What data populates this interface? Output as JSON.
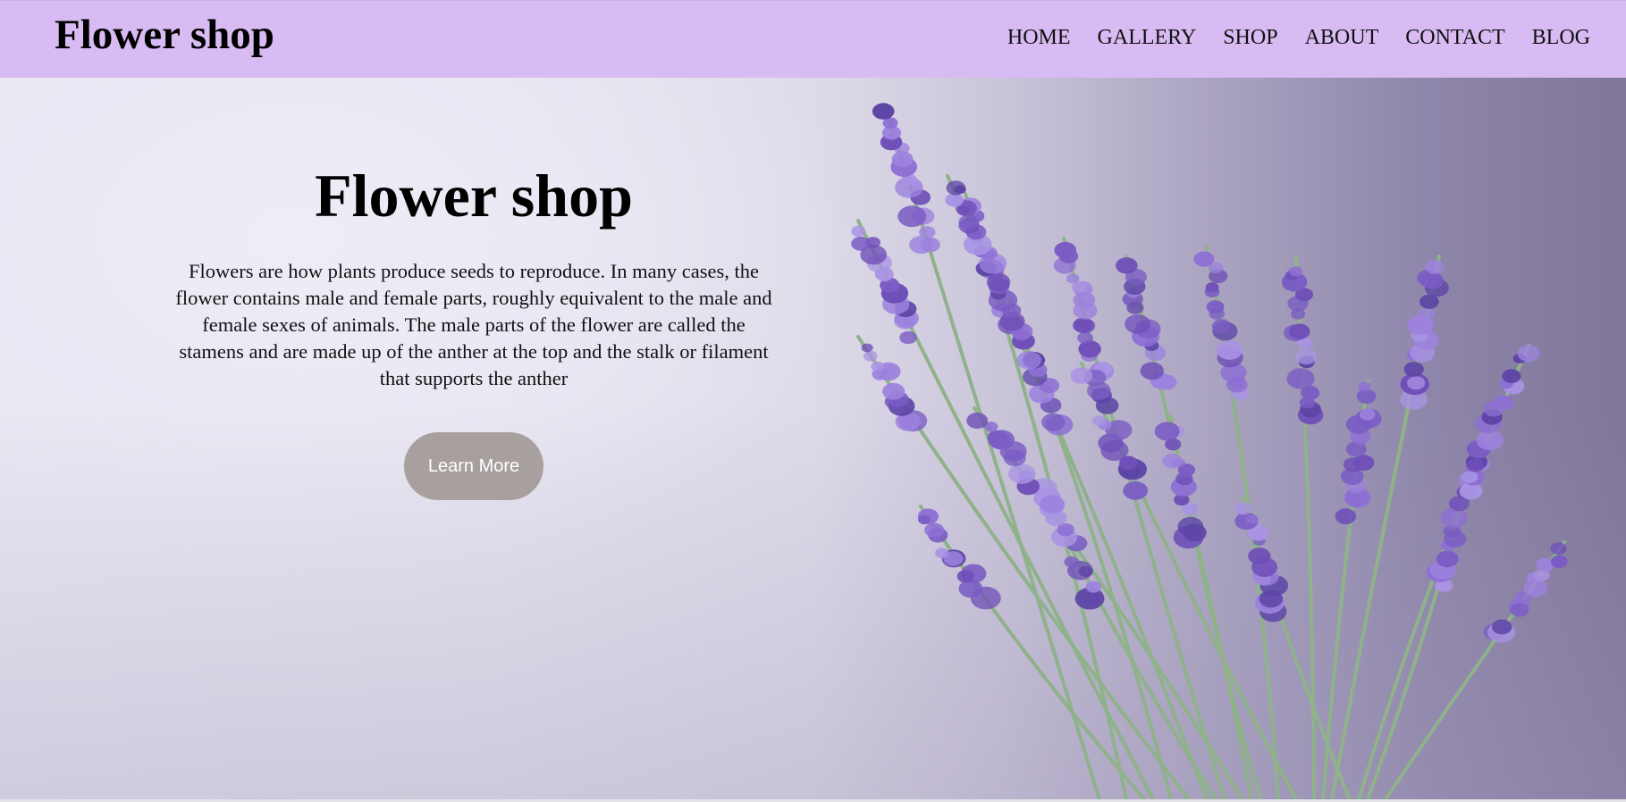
{
  "header": {
    "brand": "Flower shop",
    "nav": [
      "HOME",
      "GALLERY",
      "SHOP",
      "ABOUT",
      "CONTACT",
      "BLOG"
    ]
  },
  "hero": {
    "title": "Flower shop",
    "description": "Flowers are how plants produce seeds to reproduce. In many cases, the flower contains male and female parts, roughly equivalent to the male and female sexes of animals. The male parts of the flower are called the stamens and are made up of the anther at the top and the stalk or filament that supports the anther",
    "button_label": "Learn More",
    "image": "lavender-bouquet"
  },
  "colors": {
    "navbar_bg": "#d9bbf3",
    "button_bg": "#a8a09f",
    "lavender": "#8d6fd4",
    "stem": "#8fb28a"
  }
}
